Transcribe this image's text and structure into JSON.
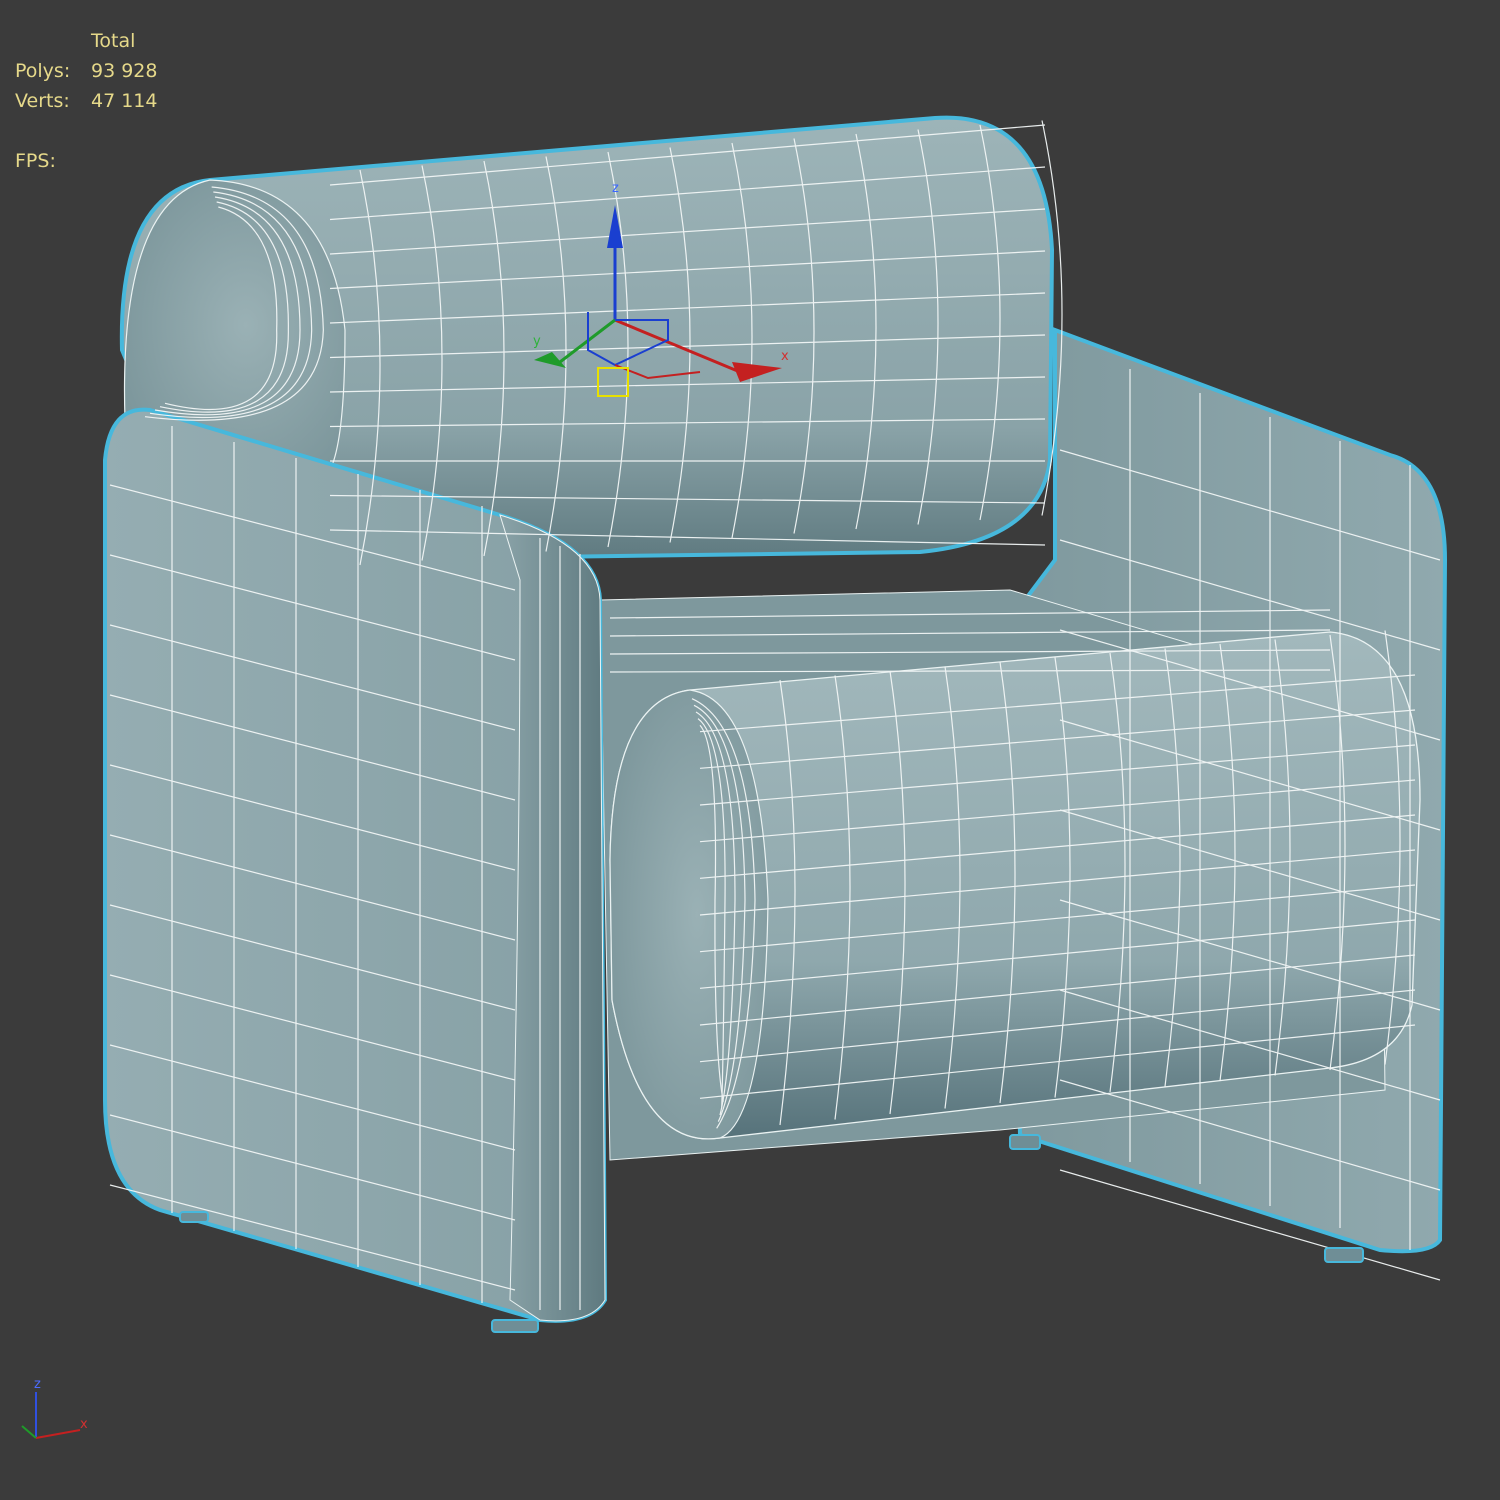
{
  "stats": {
    "header": "Total",
    "polys_label": "Polys:",
    "polys_value": "93 928",
    "verts_label": "Verts:",
    "verts_value": "47 114",
    "fps_label": "FPS:",
    "fps_value": ""
  },
  "gizmo": {
    "x_label": "x",
    "y_label": "y",
    "z_label": "z"
  },
  "view_axis": {
    "x_label": "x",
    "z_label": "z"
  },
  "colors": {
    "background": "#3b3b3b",
    "fabric": "#8fa8ad",
    "wire": "#f2f6f6",
    "selection": "#47b8dc",
    "stats_text": "#e6d98a",
    "axis_x": "#c42020",
    "axis_y": "#1f9b2a",
    "axis_z": "#1a3fd0"
  },
  "icons": [
    "transform-gizmo-icon",
    "view-axis-tripod-icon"
  ]
}
